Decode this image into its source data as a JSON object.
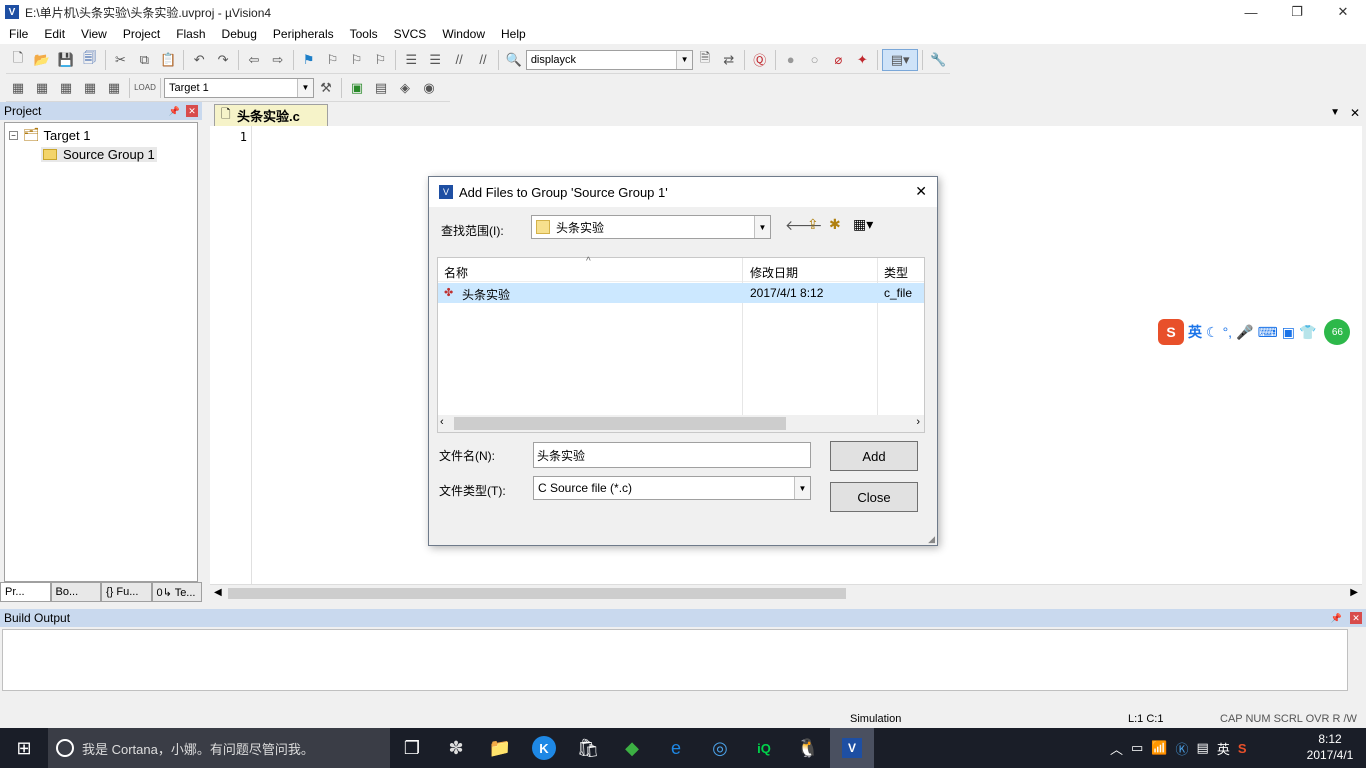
{
  "window": {
    "title": "E:\\单片机\\头条实验\\头条实验.uvproj - µVision4",
    "minimize": "—",
    "restore": "❐",
    "close": "✕"
  },
  "menu": [
    "File",
    "Edit",
    "View",
    "Project",
    "Flash",
    "Debug",
    "Peripherals",
    "Tools",
    "SVCS",
    "Window",
    "Help"
  ],
  "toolbar": {
    "find_combo": "displayck",
    "target_combo": "Target 1"
  },
  "project_panel": {
    "title": "Project",
    "pin": "📌",
    "close": "✕",
    "tree": {
      "target": "Target 1",
      "group": "Source Group 1"
    },
    "tabs": [
      "Pr...",
      "Bo...",
      "{} Fu...",
      "0↳ Te..."
    ]
  },
  "editor": {
    "tab": "头条实验.c",
    "line_number": "1",
    "menu_arrow": "▼",
    "close": "✕"
  },
  "dialog": {
    "title": "Add Files to Group 'Source Group 1'",
    "close": "✕",
    "lookin_label": "查找范围(I):",
    "lookin_value": "头条实验",
    "columns": [
      "名称",
      "修改日期",
      "类型"
    ],
    "rows": [
      {
        "name": "头条实验",
        "date": "2017/4/1 8:12",
        "type": "c_file"
      }
    ],
    "filename_label": "文件名(N):",
    "filename_value": "头条实验",
    "filetype_label": "文件类型(T):",
    "filetype_value": "C Source file (*.c)",
    "add_button": "Add",
    "close_button": "Close"
  },
  "build_output": {
    "title": "Build Output"
  },
  "status": {
    "sim": "Simulation",
    "pos": "L:1 C:1",
    "flags": "CAP  NUM  SCRL  OVR  R /W"
  },
  "ime": {
    "lang": "英",
    "badge": "66"
  },
  "taskbar": {
    "search": "我是 Cortana，小娜。有问题尽管问我。",
    "time": "8:12",
    "date": "2017/4/1",
    "ime": "英"
  }
}
